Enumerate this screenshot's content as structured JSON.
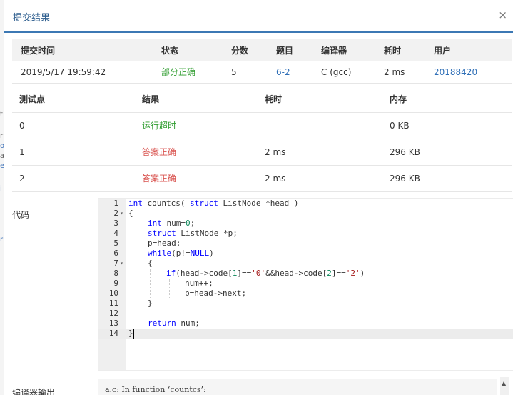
{
  "modal": {
    "title": "提交结果",
    "close_glyph": "×"
  },
  "submission_table": {
    "headers": [
      "提交时间",
      "状态",
      "分数",
      "题目",
      "编译器",
      "耗时",
      "用户"
    ],
    "row": {
      "time": "2019/5/17 19:59:42",
      "status": "部分正确",
      "score": "5",
      "problem": "6-2",
      "compiler": "C (gcc)",
      "elapsed": "2 ms",
      "user": "20188420"
    }
  },
  "case_table": {
    "headers": [
      "测试点",
      "结果",
      "耗时",
      "内存"
    ],
    "rows": [
      {
        "id": "0",
        "result": "运行超时",
        "time": "--",
        "memory": "0 KB"
      },
      {
        "id": "1",
        "result": "答案正确",
        "time": "2 ms",
        "memory": "296 KB"
      },
      {
        "id": "2",
        "result": "答案正确",
        "time": "2 ms",
        "memory": "296 KB"
      }
    ]
  },
  "code_label": "代码",
  "code_lines": [
    {
      "n": "1",
      "fold": ""
    },
    {
      "n": "2",
      "fold": "▾"
    },
    {
      "n": "3",
      "fold": ""
    },
    {
      "n": "4",
      "fold": ""
    },
    {
      "n": "5",
      "fold": ""
    },
    {
      "n": "6",
      "fold": ""
    },
    {
      "n": "7",
      "fold": "▾"
    },
    {
      "n": "8",
      "fold": ""
    },
    {
      "n": "9",
      "fold": ""
    },
    {
      "n": "10",
      "fold": ""
    },
    {
      "n": "11",
      "fold": ""
    },
    {
      "n": "12",
      "fold": ""
    },
    {
      "n": "13",
      "fold": ""
    },
    {
      "n": "14",
      "fold": ""
    }
  ],
  "code_tokens": {
    "l1": [
      "int",
      " countcs( ",
      "struct",
      " ListNode *head )"
    ],
    "l2": "{",
    "l3": [
      "int",
      " num=",
      "0",
      ";"
    ],
    "l4": [
      "struct",
      " ListNode *p;"
    ],
    "l5": "p=head;",
    "l6": [
      "while",
      "(p!=",
      "NULL",
      ")"
    ],
    "l7": "{",
    "l8": [
      "if",
      "(head->code[",
      "1",
      "]==",
      "'0'",
      "&&head->code[",
      "2",
      "]==",
      "'2'",
      ")"
    ],
    "l9": "num++;",
    "l10": "p=head->next;",
    "l11": "}",
    "l13": [
      "return",
      " num;"
    ],
    "l14": "}"
  },
  "compiler_label": "编译器输出",
  "compiler_output": "a.c: In function ‘countcs’:",
  "scroll_up_glyph": "▲",
  "background_glyphs": [
    "t",
    "r",
    "o",
    "a",
    "e",
    "i",
    "r"
  ]
}
